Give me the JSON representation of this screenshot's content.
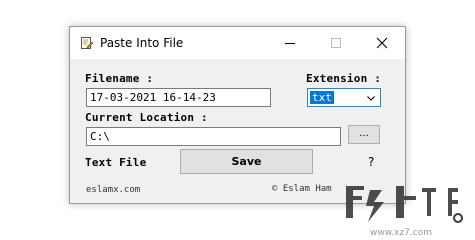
{
  "window": {
    "title": "Paste Into File",
    "icons": {
      "app": "paste-file-icon",
      "minimize": "minimize-icon",
      "maximize": "maximize-icon",
      "close": "close-icon"
    }
  },
  "form": {
    "filename_label": "Filename :",
    "filename_value": "17-03-2021 16-14-23",
    "extension_label": "Extension :",
    "extension_value": "txt",
    "location_label": "Current Location :",
    "location_value": "C:\\",
    "browse_label": "...",
    "file_type_label": "Text File",
    "save_label": "Save",
    "help_label": "?"
  },
  "footer": {
    "website": "eslamx.com",
    "copyright": "© Eslam Ham"
  },
  "watermark": {
    "text": "www.xz7.com"
  }
}
